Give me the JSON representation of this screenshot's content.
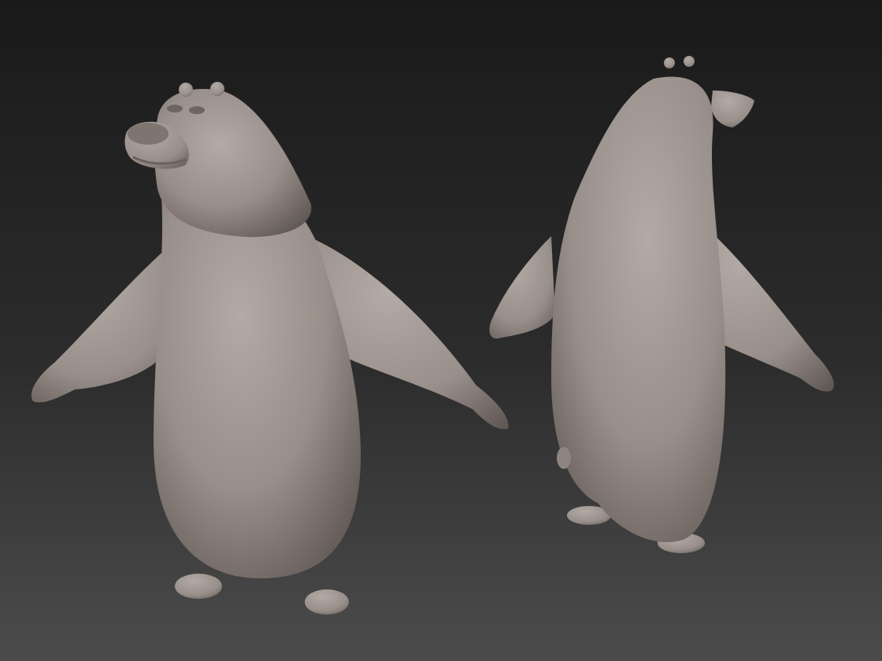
{
  "scene": {
    "background_top": "#1a1a1a",
    "background_horizon": "#2c2c2c",
    "background_bottom": "#4c4c4c",
    "material_light": "#b4aaa5",
    "material_mid": "#998f8a",
    "material_shadow": "#5f5753",
    "models": [
      {
        "view": "front-three-quarter"
      },
      {
        "view": "back-three-quarter"
      }
    ]
  }
}
